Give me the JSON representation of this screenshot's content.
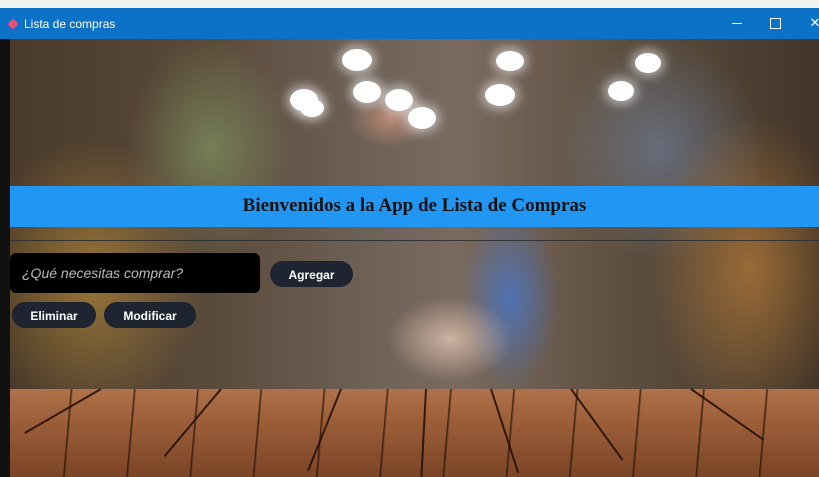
{
  "window": {
    "title": "Lista de compras",
    "accent_color": "#0b72c7",
    "controls": {
      "minimize_icon": "minimize-icon",
      "maximize_icon": "maximize-icon",
      "close_label": "✕"
    }
  },
  "banner": {
    "title": "Bienvenidos a la App de Lista de Compras",
    "color": "#2196f3"
  },
  "form": {
    "item_input": {
      "placeholder": "¿Qué necesitas comprar?",
      "value": ""
    },
    "add_label": "Agregar",
    "delete_label": "Eliminar",
    "modify_label": "Modificar"
  }
}
